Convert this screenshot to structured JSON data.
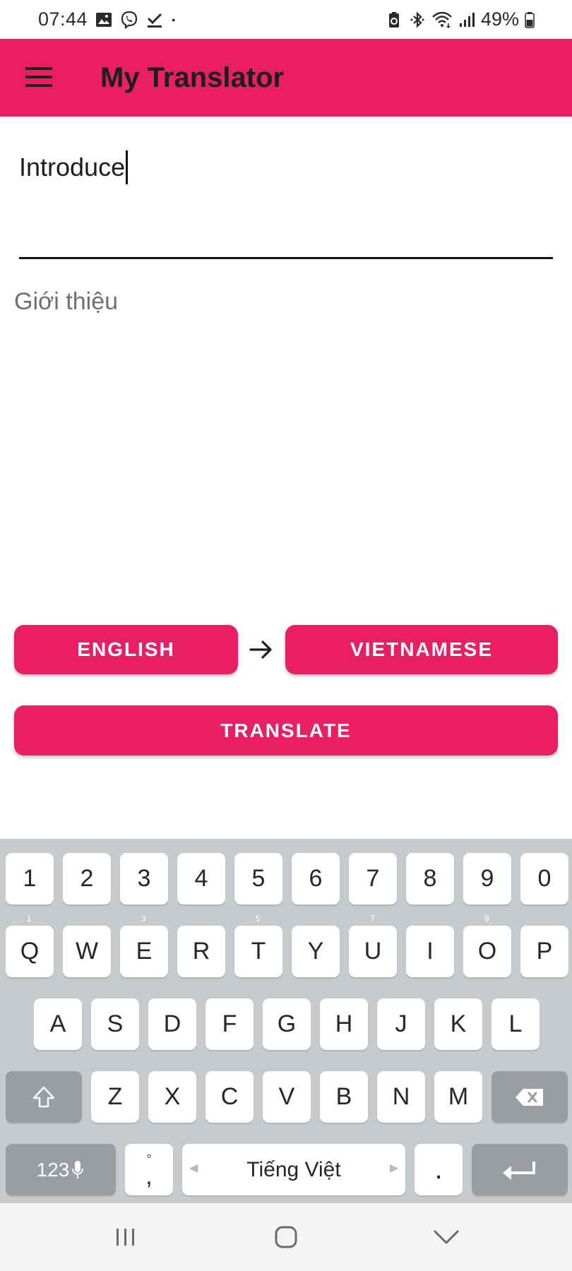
{
  "status_bar": {
    "time": "07:44",
    "battery_percent": "49%",
    "left_icons": [
      "gallery-icon",
      "viber-icon",
      "download-check-icon",
      "dot-icon"
    ],
    "right_icons": [
      "battery-saver-icon",
      "bluetooth-icon",
      "wifi-icon",
      "signal-icon",
      "battery-icon"
    ]
  },
  "app_bar": {
    "title": "My Translator",
    "background_color": "#e91e63"
  },
  "input": {
    "value": "Introduce"
  },
  "output": {
    "text": "Giới thiệu"
  },
  "buttons": {
    "source_language": "ENGLISH",
    "target_language": "VIETNAMESE",
    "translate": "TRANSLATE"
  },
  "keyboard": {
    "number_row": [
      "1",
      "2",
      "3",
      "4",
      "5",
      "6",
      "7",
      "8",
      "9",
      "0"
    ],
    "row1": [
      "Q",
      "W",
      "E",
      "R",
      "T",
      "Y",
      "U",
      "I",
      "O",
      "P"
    ],
    "row1_hints": [
      "1",
      "",
      "3",
      "",
      "5",
      "",
      "7",
      "",
      "9",
      ""
    ],
    "row2": [
      "A",
      "S",
      "D",
      "F",
      "G",
      "H",
      "J",
      "K",
      "L"
    ],
    "row3": [
      "Z",
      "X",
      "C",
      "V",
      "B",
      "N",
      "M"
    ],
    "symbols_key": "123",
    "comma_key": ",",
    "comma_hint": "°",
    "space_label": "Tiếng Việt",
    "period_key": "."
  },
  "nav_bar": {
    "icons": [
      "recent-apps-icon",
      "home-icon",
      "back-icon"
    ]
  }
}
